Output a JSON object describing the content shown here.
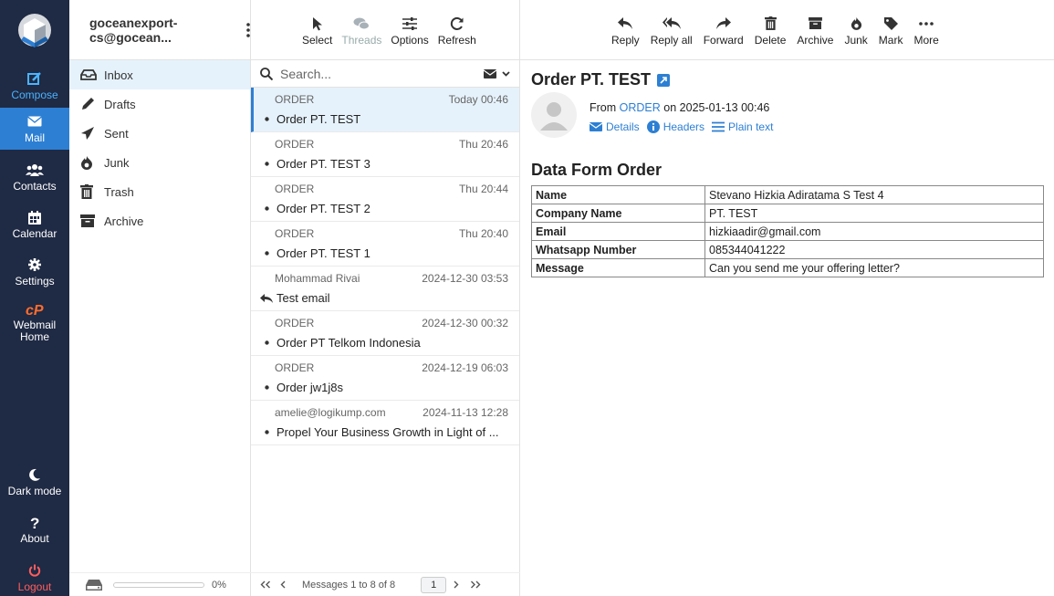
{
  "nav": {
    "items": [
      {
        "label": "Compose",
        "icon": "compose-icon"
      },
      {
        "label": "Mail",
        "icon": "mail-icon"
      },
      {
        "label": "Contacts",
        "icon": "contacts-icon"
      },
      {
        "label": "Calendar",
        "icon": "calendar-icon"
      },
      {
        "label": "Settings",
        "icon": "gear-icon"
      },
      {
        "label": "Webmail Home",
        "icon": "cpanel-icon"
      },
      {
        "label": "Dark mode",
        "icon": "moon-icon"
      },
      {
        "label": "About",
        "icon": "question-icon"
      },
      {
        "label": "Logout",
        "icon": "power-icon"
      }
    ]
  },
  "account": {
    "name": "goceanexport-cs@gocean..."
  },
  "folders": [
    {
      "label": "Inbox",
      "icon": "inbox-icon"
    },
    {
      "label": "Drafts",
      "icon": "pencil-icon"
    },
    {
      "label": "Sent",
      "icon": "paper-plane-icon"
    },
    {
      "label": "Junk",
      "icon": "fire-icon"
    },
    {
      "label": "Trash",
      "icon": "trash-icon"
    },
    {
      "label": "Archive",
      "icon": "archive-icon"
    }
  ],
  "quota": {
    "percent_label": "0%",
    "used_fraction": 0
  },
  "list_toolbar": {
    "select": "Select",
    "threads": "Threads",
    "options": "Options",
    "refresh": "Refresh"
  },
  "search": {
    "placeholder": "Search..."
  },
  "messages": [
    {
      "from": "ORDER",
      "date": "Today 00:46",
      "subject": "Order PT. TEST",
      "marker": "bullet"
    },
    {
      "from": "ORDER",
      "date": "Thu 20:46",
      "subject": "Order PT. TEST 3",
      "marker": "bullet"
    },
    {
      "from": "ORDER",
      "date": "Thu 20:44",
      "subject": "Order PT. TEST 2",
      "marker": "bullet"
    },
    {
      "from": "ORDER",
      "date": "Thu 20:40",
      "subject": "Order PT. TEST 1",
      "marker": "bullet"
    },
    {
      "from": "Mohammad Rivai",
      "date": "2024-12-30 03:53",
      "subject": "Test email",
      "marker": "reply"
    },
    {
      "from": "ORDER",
      "date": "2024-12-30 00:32",
      "subject": "Order PT Telkom Indonesia",
      "marker": "bullet"
    },
    {
      "from": "ORDER",
      "date": "2024-12-19 06:03",
      "subject": "Order jw1j8s",
      "marker": "bullet"
    },
    {
      "from": "amelie@logikump.com",
      "date": "2024-11-13 12:28",
      "subject": "Propel Your Business Growth in Light of ...",
      "marker": "bullet"
    }
  ],
  "pager": {
    "summary": "Messages 1 to 8 of 8",
    "page": "1"
  },
  "message_toolbar": {
    "reply": "Reply",
    "reply_all": "Reply all",
    "forward": "Forward",
    "delete": "Delete",
    "archive": "Archive",
    "junk": "Junk",
    "mark": "Mark",
    "more": "More"
  },
  "message": {
    "subject": "Order PT. TEST",
    "from_prefix": "From",
    "from_name": "ORDER",
    "date_text": "on 2025-01-13 00:46",
    "links": {
      "details": "Details",
      "headers": "Headers",
      "plain": "Plain text"
    },
    "body_title": "Data Form Order",
    "table": [
      {
        "key": "Name",
        "value": "Stevano Hizkia Adiratama S Test 4"
      },
      {
        "key": "Company Name",
        "value": "PT. TEST"
      },
      {
        "key": "Email",
        "value": "hizkiaadir@gmail.com"
      },
      {
        "key": "Whatsapp Number",
        "value": "085344041222"
      },
      {
        "key": "Message",
        "value": "Can you send me your offering letter?"
      }
    ]
  },
  "colors": {
    "accent": "#2d7fd3",
    "nav_bg": "#1f2a44",
    "logout": "#ff5e5e"
  }
}
